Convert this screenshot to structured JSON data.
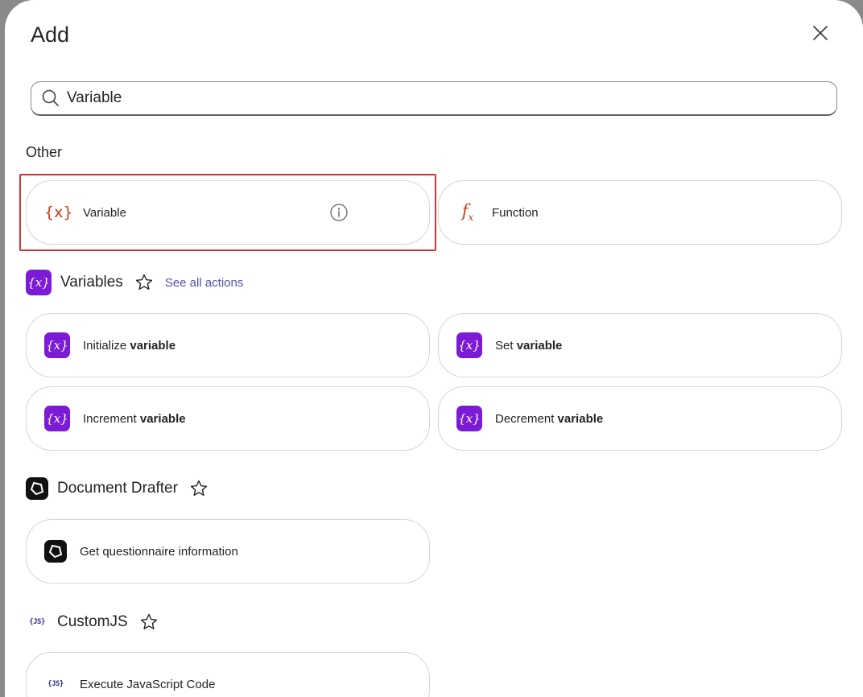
{
  "dialog": {
    "title": "Add",
    "close_icon": "close-icon"
  },
  "search": {
    "value": "Variable",
    "icon": "search-icon"
  },
  "other": {
    "label": "Other",
    "cards": [
      {
        "label": "Variable",
        "icon": "variable-icon",
        "highlighted": true,
        "has_info": true
      },
      {
        "label": "Function",
        "icon": "function-icon"
      }
    ]
  },
  "variables": {
    "name": "Variables",
    "see_all": "See all actions",
    "cards": [
      {
        "prefix": "Initialize ",
        "bold": "variable"
      },
      {
        "prefix": "Set ",
        "bold": "variable"
      },
      {
        "prefix": "Increment ",
        "bold": "variable"
      },
      {
        "prefix": "Decrement ",
        "bold": "variable"
      }
    ]
  },
  "document_drafter": {
    "name": "Document Drafter",
    "cards": [
      {
        "label": "Get questionnaire information"
      }
    ]
  },
  "customjs": {
    "name": "CustomJS",
    "icon_text": "{JS}",
    "cards": [
      {
        "label": "Execute JavaScript Code"
      }
    ]
  },
  "colors": {
    "accent": "#4f52b2",
    "variables_purple": "#7c1bd6",
    "highlight_red": "#d13438",
    "orange_icon": "#c43e1c"
  }
}
